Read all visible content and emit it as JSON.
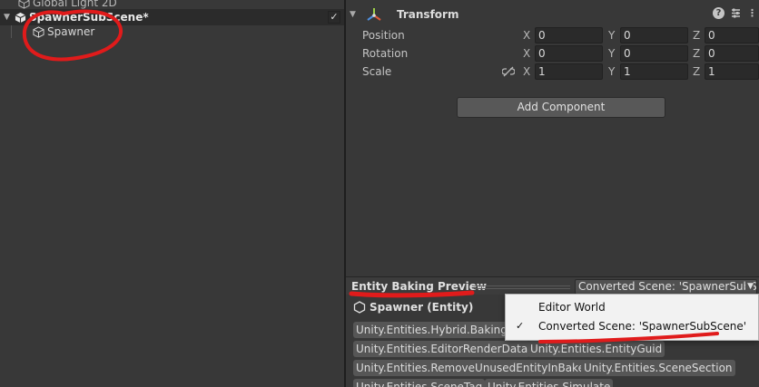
{
  "hierarchy": {
    "items": [
      {
        "label": "Global Light 2D"
      },
      {
        "label": "SpawnerSubScene*"
      },
      {
        "label": "Spawner"
      }
    ],
    "check": "✓"
  },
  "inspector": {
    "component_title": "Transform",
    "help": "?",
    "rows": [
      {
        "label": "Position",
        "x": "0",
        "y": "0",
        "z": "0"
      },
      {
        "label": "Rotation",
        "x": "0",
        "y": "0",
        "z": "0"
      },
      {
        "label": "Scale",
        "x": "1",
        "y": "1",
        "z": "1"
      }
    ],
    "axes": {
      "x": "X",
      "y": "Y",
      "z": "Z"
    },
    "add_component": "Add Component"
  },
  "baking_preview": {
    "title": "Entity Baking Preview",
    "dropdown_value": "Converted Scene: 'SpawnerSubScene'",
    "entity_title": "Spawner (Entity)",
    "chips": [
      "Unity.Entities.Hybrid.Baking.AdditionalEntitiesBakingData",
      "Unity.Entities.EditorRenderData",
      "Unity.Entities.EntityGuid",
      "Unity.Entities.RemoveUnusedEntityInBake",
      "Unity.Entities.SceneSection",
      "Unity.Entities.SceneTag",
      "Unity.Entities.Simulate"
    ]
  },
  "menu": {
    "items": [
      {
        "label": "Editor World",
        "checked": false
      },
      {
        "label": "Converted Scene: 'SpawnerSubScene'",
        "checked": true
      }
    ],
    "check": "✓"
  },
  "colors": {
    "annotation": "#e01b1b",
    "panel": "#383838",
    "menu_bg": "#f2f2f2"
  }
}
